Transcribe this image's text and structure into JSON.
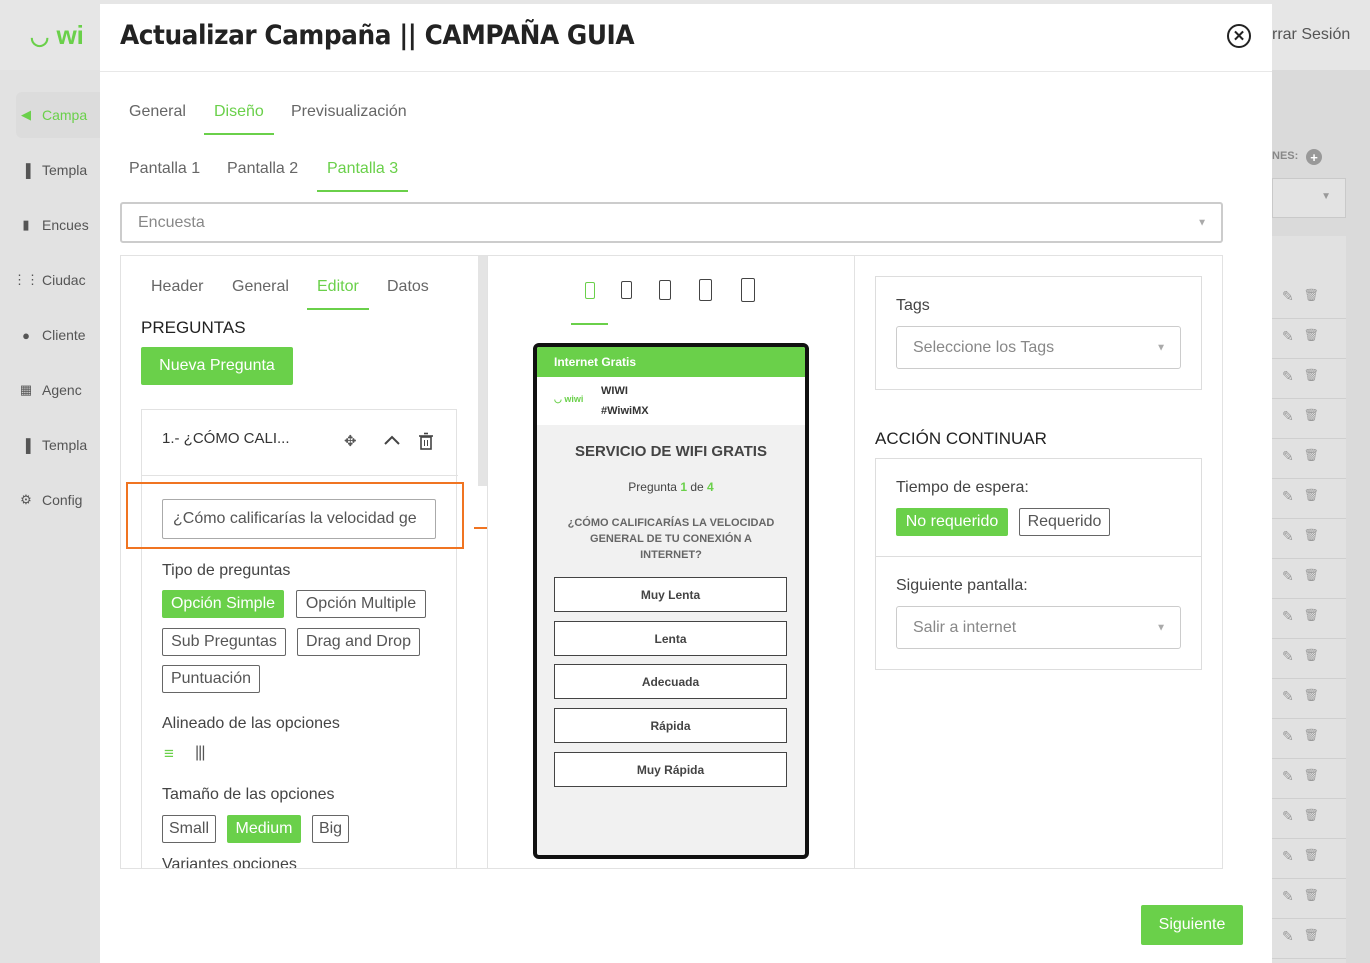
{
  "background": {
    "logo": "wi",
    "logout": "rrar Sesión",
    "sidebar": [
      "Campa",
      "Templa",
      "Encues",
      "Ciudac",
      "Cliente",
      "Agenc",
      "Templa",
      "Config"
    ],
    "right_label": "NES:"
  },
  "modal": {
    "title": "Actualizar Campaña || CAMPAÑA GUIA",
    "main_tabs": [
      "General",
      "Diseño",
      "Previsualización"
    ],
    "screen_tabs": [
      "Pantalla 1",
      "Pantalla 2",
      "Pantalla 3"
    ],
    "template_select": "Encuesta",
    "editor_tabs": [
      "Header",
      "General",
      "Editor",
      "Datos"
    ],
    "questions_heading": "PREGUNTAS",
    "new_question_button": "Nueva Pregunta",
    "question_item": {
      "title": "1.- ¿CÓMO CALI...",
      "input_value": "¿Cómo calificarías la velocidad ge"
    },
    "question_type_label": "Tipo de preguntas",
    "question_types": [
      "Opción Simple",
      "Opción Multiple",
      "Sub Preguntas",
      "Drag and Drop",
      "Puntuación"
    ],
    "alignment_label": "Alineado de las opciones",
    "size_label": "Tamaño de las opciones",
    "sizes": [
      "Small",
      "Medium",
      "Big"
    ],
    "variants_label": "Variantes opciones",
    "preview": {
      "header_bar": "Internet Gratis",
      "brand_name": "WIWI",
      "brand_tag": "#WiwiMX",
      "brand_logo": "wiwi",
      "service_title": "SERVICIO DE WIFI GRATIS",
      "progress_prefix": "Pregunta",
      "progress_current": "1",
      "progress_mid": "de",
      "progress_total": "4",
      "question": "¿CÓMO CALIFICARÍAS LA VELOCIDAD GENERAL DE TU CONEXIÓN A INTERNET?",
      "options": [
        "Muy Lenta",
        "Lenta",
        "Adecuada",
        "Rápida",
        "Muy Rápida"
      ]
    },
    "tags": {
      "label": "Tags",
      "placeholder": "Seleccione los Tags"
    },
    "continue_action": {
      "heading": "ACCIÓN CONTINUAR",
      "wait_label": "Tiempo de espera:",
      "wait_options": [
        "No requerido",
        "Requerido"
      ],
      "next_screen_label": "Siguiente pantalla:",
      "next_screen_value": "Salir a internet"
    },
    "next_button": "Siguiente"
  },
  "colors": {
    "accent": "#6ad04a",
    "highlight": "#f07421"
  }
}
